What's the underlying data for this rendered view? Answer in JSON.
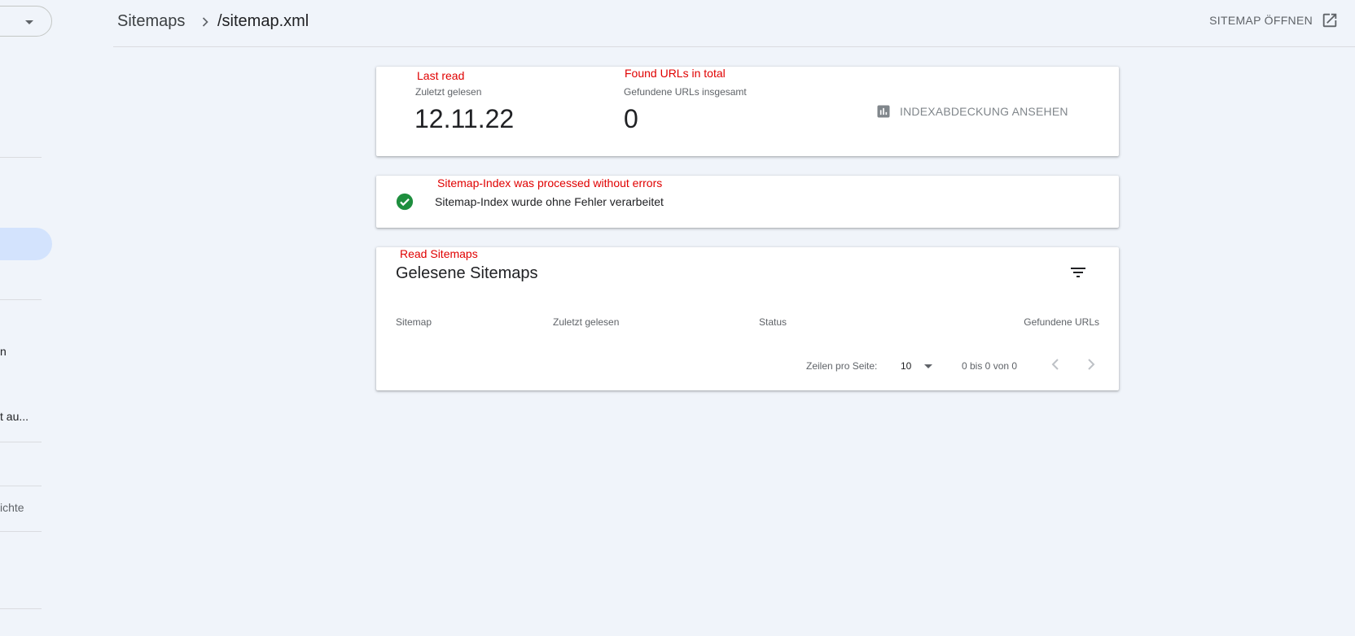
{
  "sidebar": {
    "items": [
      {
        "label": "n"
      },
      {
        "label": "t au..."
      },
      {
        "label": "ichte"
      }
    ]
  },
  "header": {
    "breadcrumb_parent": "Sitemaps",
    "breadcrumb_current": "/sitemap.xml",
    "open_sitemap_label": "SITEMAP ÖFFNEN"
  },
  "summary": {
    "last_read_annotation": "Last read",
    "last_read_label": "Zuletzt gelesen",
    "last_read_value": "12.11.22",
    "found_urls_annotation": "Found URLs in total",
    "found_urls_label": "Gefundene URLs insgesamt",
    "found_urls_value": "0",
    "coverage_button_label": "INDEXABDECKUNG ANSEHEN"
  },
  "status": {
    "annotation": "Sitemap-Index was processed without errors",
    "text": "Sitemap-Index wurde ohne Fehler verarbeitet",
    "color": "#1e8e3e"
  },
  "sitemaps_table": {
    "annotation": "Read Sitemaps",
    "title": "Gelesene Sitemaps",
    "columns": [
      "Sitemap",
      "Zuletzt gelesen",
      "Status",
      "Gefundene URLs"
    ],
    "rows": [],
    "rows_per_page_label": "Zeilen pro Seite:",
    "rows_per_page_value": "10",
    "range_text": "0 bis 0 von 0"
  },
  "colors": {
    "annotation": "#e00000",
    "background": "#f0f4fa",
    "active_nav": "#d3e3fd"
  }
}
